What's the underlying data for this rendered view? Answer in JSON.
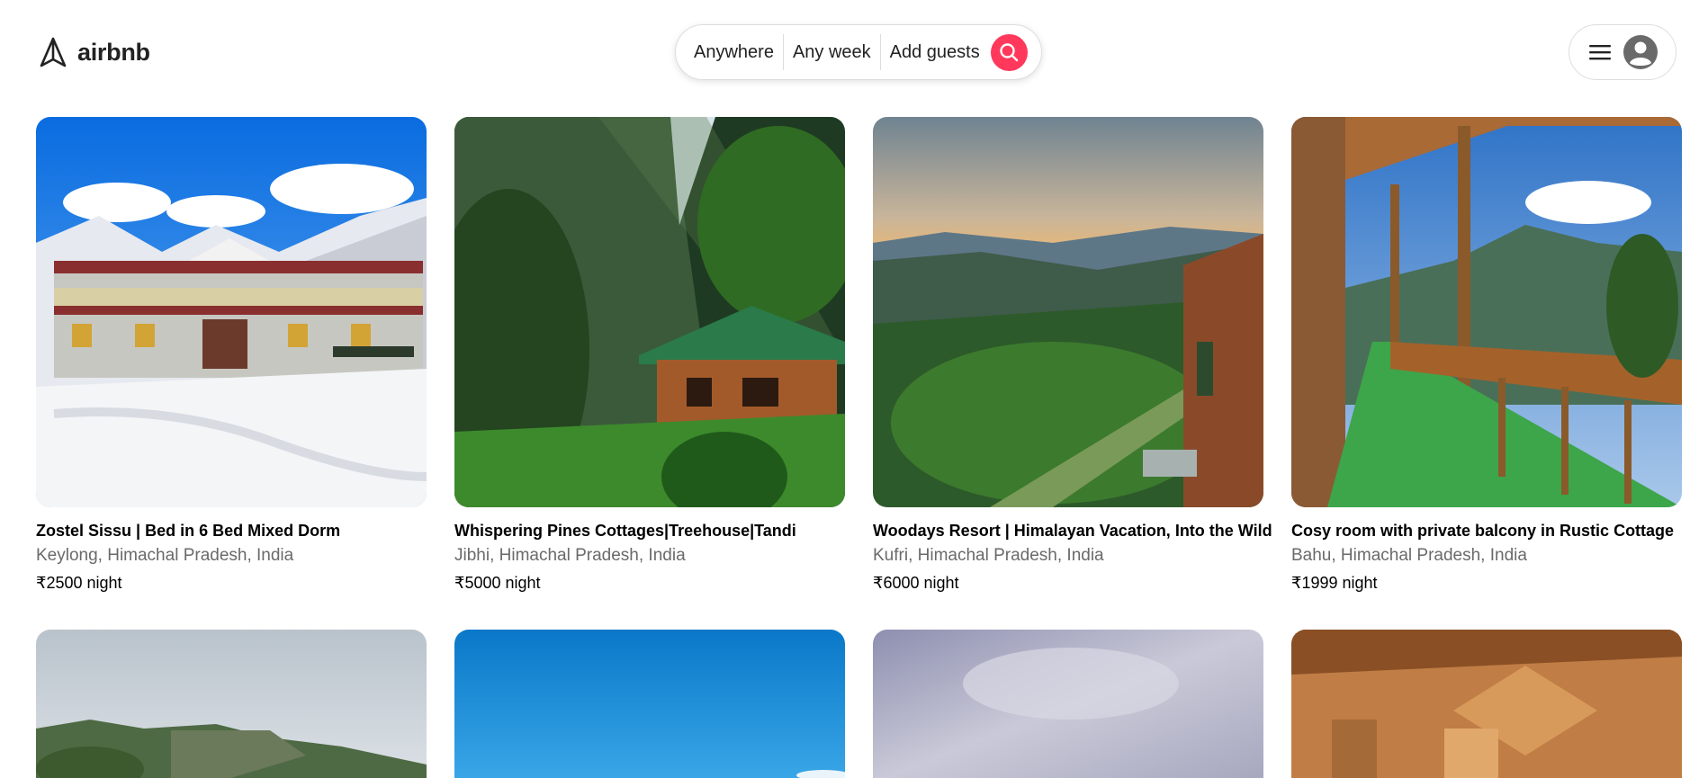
{
  "brand": {
    "name": "airbnb",
    "accent": "#ff385c"
  },
  "search": {
    "where": "Anywhere",
    "when": "Any week",
    "who": "Add guests",
    "button_icon": "search-icon"
  },
  "user_menu": {
    "menu_icon": "hamburger-menu-icon",
    "avatar_icon": "user-avatar-icon"
  },
  "listings": [
    {
      "title": "Zostel Sissu | Bed in 6 Bed Mixed Dorm",
      "location": "Keylong, Himachal Pradesh, India",
      "price": "₹2500 night"
    },
    {
      "title": "Whispering Pines Cottages|Treehouse|Tandi",
      "location": "Jibhi, Himachal Pradesh, India",
      "price": "₹5000 night"
    },
    {
      "title": "Woodays Resort | Himalayan Vacation, Into the Wild",
      "location": "Kufri, Himachal Pradesh, India",
      "price": "₹6000 night"
    },
    {
      "title": "Cosy room with private balcony in Rustic Cottage",
      "location": "Bahu, Himachal Pradesh, India",
      "price": "₹1999 night"
    }
  ]
}
